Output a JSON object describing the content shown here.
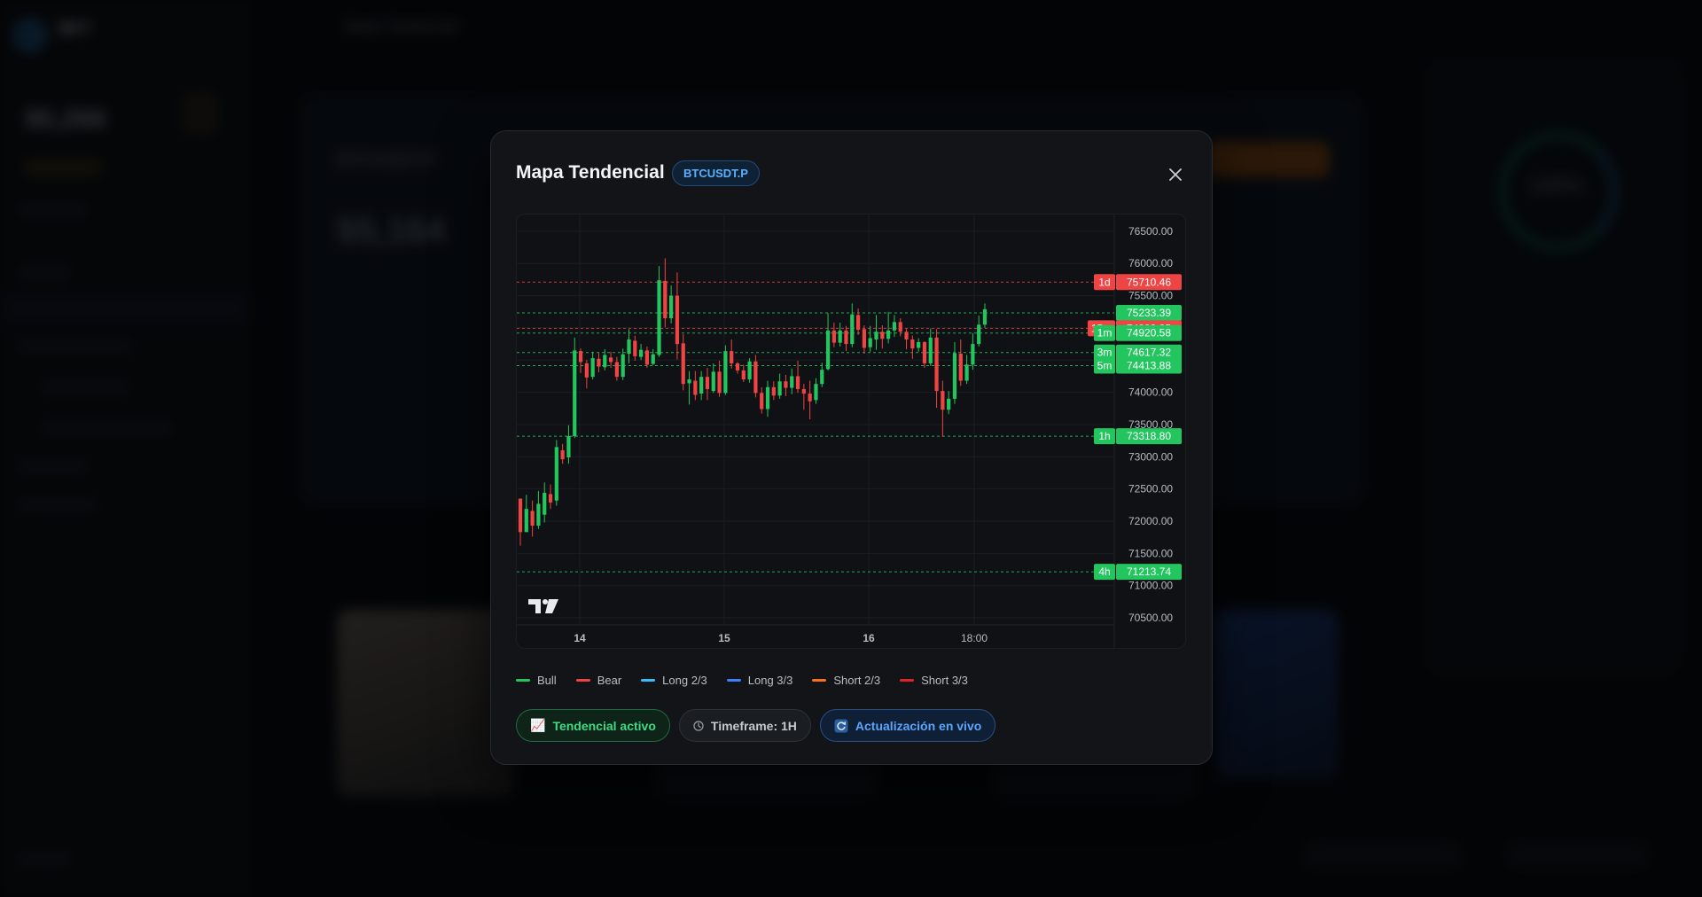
{
  "modal": {
    "title": "Mapa Tendencial",
    "symbol": "BTCUSDT.P"
  },
  "chart_data": {
    "type": "candlestick",
    "x_ticks": [
      "14",
      "15",
      "16",
      "18:00"
    ],
    "y_ticks": [
      76500,
      76000,
      75500,
      75000,
      74500,
      74000,
      73500,
      73000,
      72500,
      72000,
      71500,
      71000,
      70500
    ],
    "y_tick_labels": [
      "76500.00",
      "76000.00",
      "75500.00",
      "75000.00",
      "74500.00",
      "74000.00",
      "73500.00",
      "73000.00",
      "72500.00",
      "72000.00",
      "71500.00",
      "71000.00",
      "70500.00"
    ],
    "ylim": [
      70390,
      76760
    ],
    "levels": [
      {
        "tf": "1d",
        "value": "75710.46",
        "price": 75710.46,
        "color": "#ef4444"
      },
      {
        "tf": "",
        "value": "75233.39",
        "price": 75233.39,
        "color": "#22c55e"
      },
      {
        "tf": "15m",
        "value": "74993.35",
        "price": 74993.35,
        "color": "#ef4444"
      },
      {
        "tf": "1m",
        "value": "74920.58",
        "price": 74920.58,
        "color": "#22c55e"
      },
      {
        "tf": "3m",
        "value": "74617.32",
        "price": 74617.32,
        "color": "#22c55e"
      },
      {
        "tf": "5m",
        "value": "74413.88",
        "price": 74413.88,
        "color": "#22c55e"
      },
      {
        "tf": "1h",
        "value": "73318.80",
        "price": 73318.8,
        "color": "#22c55e"
      },
      {
        "tf": "4h",
        "value": "71213.74",
        "price": 71213.74,
        "color": "#22c55e"
      }
    ],
    "candles": [
      [
        72350,
        71830,
        71620,
        72180
      ],
      [
        71830,
        72190,
        71900,
        72410
      ],
      [
        72160,
        71930,
        71760,
        72320
      ],
      [
        71930,
        72270,
        71880,
        72470
      ],
      [
        72100,
        72440,
        71980,
        72600
      ],
      [
        72420,
        72290,
        72190,
        72570
      ],
      [
        72320,
        73150,
        72240,
        73260
      ],
      [
        73100,
        72960,
        72890,
        73200
      ],
      [
        72990,
        73320,
        72890,
        73490
      ],
      [
        73320,
        74650,
        73290,
        74850
      ],
      [
        74640,
        74470,
        74300,
        74680
      ],
      [
        74450,
        74230,
        74060,
        74500
      ],
      [
        74240,
        74530,
        74200,
        74630
      ],
      [
        74520,
        74400,
        74310,
        74610
      ],
      [
        74390,
        74580,
        74340,
        74670
      ],
      [
        74540,
        74470,
        74380,
        74630
      ],
      [
        74470,
        74240,
        74180,
        74550
      ],
      [
        74240,
        74590,
        74190,
        74680
      ],
      [
        74600,
        74820,
        74450,
        74980
      ],
      [
        74800,
        74560,
        74490,
        74880
      ],
      [
        74550,
        74660,
        74500,
        74750
      ],
      [
        74650,
        74430,
        74380,
        74710
      ],
      [
        74440,
        74590,
        74420,
        74670
      ],
      [
        74580,
        75740,
        74550,
        75960
      ],
      [
        75730,
        75150,
        75010,
        76080
      ],
      [
        75150,
        75500,
        75070,
        75660
      ],
      [
        75500,
        74750,
        74510,
        75860
      ],
      [
        74760,
        74130,
        74030,
        74900
      ],
      [
        74140,
        74200,
        73810,
        74330
      ],
      [
        74180,
        73960,
        73880,
        74330
      ],
      [
        73980,
        74240,
        73880,
        74330
      ],
      [
        74240,
        74050,
        73880,
        74380
      ],
      [
        74020,
        74320,
        73990,
        74450
      ],
      [
        74320,
        73990,
        73930,
        74490
      ],
      [
        73990,
        74640,
        73960,
        74730
      ],
      [
        74640,
        74450,
        74370,
        74820
      ],
      [
        74450,
        74340,
        74290,
        74470
      ],
      [
        74340,
        74200,
        74160,
        74430
      ],
      [
        74200,
        74480,
        74150,
        74530
      ],
      [
        74480,
        73990,
        73920,
        74580
      ],
      [
        73990,
        73740,
        73670,
        74080
      ],
      [
        73740,
        74080,
        73620,
        74180
      ],
      [
        74080,
        73950,
        73880,
        74170
      ],
      [
        73950,
        74170,
        73900,
        74290
      ],
      [
        74170,
        74070,
        73940,
        74270
      ],
      [
        74070,
        74250,
        73970,
        74370
      ],
      [
        74250,
        74050,
        73990,
        74490
      ],
      [
        74050,
        73980,
        73730,
        74130
      ],
      [
        73980,
        73860,
        73580,
        74180
      ],
      [
        73880,
        74130,
        73820,
        74220
      ],
      [
        74130,
        74350,
        74080,
        74460
      ],
      [
        74360,
        74960,
        74340,
        75230
      ],
      [
        74960,
        74770,
        74700,
        75080
      ],
      [
        74770,
        74960,
        74710,
        75080
      ],
      [
        74960,
        74750,
        74640,
        75030
      ],
      [
        74750,
        75210,
        74700,
        75380
      ],
      [
        75200,
        74970,
        74890,
        75300
      ],
      [
        74980,
        74690,
        74600,
        75040
      ],
      [
        74700,
        74840,
        74630,
        75030
      ],
      [
        74820,
        74940,
        74660,
        75200
      ],
      [
        74940,
        74830,
        74680,
        75040
      ],
      [
        74830,
        74960,
        74760,
        75250
      ],
      [
        74960,
        75090,
        74860,
        75200
      ],
      [
        75090,
        74940,
        74870,
        75150
      ],
      [
        74940,
        74820,
        74670,
        74980
      ],
      [
        74820,
        74680,
        74520,
        74880
      ],
      [
        74690,
        74780,
        74630,
        74840
      ],
      [
        74780,
        74450,
        74380,
        74790
      ],
      [
        74450,
        74850,
        74410,
        74990
      ],
      [
        74850,
        74020,
        73760,
        74980
      ],
      [
        74020,
        73730,
        73310,
        74180
      ],
      [
        73730,
        73900,
        73660,
        74020
      ],
      [
        73900,
        74610,
        73820,
        74780
      ],
      [
        74600,
        74180,
        74100,
        74820
      ],
      [
        74180,
        74430,
        74130,
        74580
      ],
      [
        74430,
        74750,
        74350,
        74920
      ],
      [
        74750,
        75050,
        74710,
        75190
      ],
      [
        75050,
        75290,
        75000,
        75380
      ]
    ]
  },
  "legend": [
    {
      "label": "Bull",
      "color": "#22c55e"
    },
    {
      "label": "Bear",
      "color": "#ef4444"
    },
    {
      "label": "Long 2/3",
      "color": "#38bdf8"
    },
    {
      "label": "Long 3/3",
      "color": "#3b82f6"
    },
    {
      "label": "Short 2/3",
      "color": "#f97316"
    },
    {
      "label": "Short 3/3",
      "color": "#dc2626"
    }
  ],
  "chips": {
    "trend": "Tendencial activo",
    "timeframe": "Timeframe: 1H",
    "live": "Actualización en vivo"
  },
  "background": {
    "topbar_title": "Mapa Tendencial",
    "sidebar_brand": "BKT",
    "sidebar_balance": "$5,266",
    "main_heading": "BTCUSDT.P",
    "main_price": "$5,164",
    "gauge_value": "100%"
  }
}
